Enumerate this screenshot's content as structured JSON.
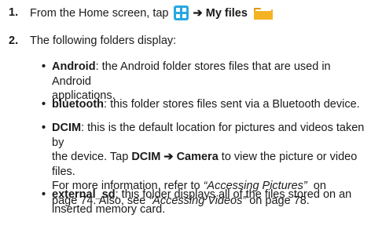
{
  "steps": [
    {
      "number": "1.",
      "text_before": "From the Home screen, tap ",
      "arrow": "➔",
      "target": "My files",
      "icons": [
        "apps-grid-icon",
        "folder-icon"
      ]
    },
    {
      "number": "2.",
      "text": "The following folders display:"
    }
  ],
  "folders": [
    {
      "name": "Android",
      "description_lines": [
        ": the Android folder stores files that are used in Android",
        "applications."
      ]
    },
    {
      "name": "bluetooth",
      "description_lines": [
        ": this folder stores files sent via a Bluetooth device."
      ]
    },
    {
      "name": "DCIM",
      "line1": ": this is the default location for pictures and videos taken by",
      "line2_pre": "the device. Tap ",
      "line2_bold": "DCIM ➔ Camera",
      "line2_post": " to view the picture or video files.",
      "line3_pre": "For more information, refer to ",
      "line3_ref": "“Accessing Pictures”",
      "line3_post": "  on",
      "line4_pre": "page 74. Also, see ",
      "line4_ref": "“Accessing Videos”",
      "line4_post": " on page 78."
    },
    {
      "name": "external_sd",
      "description_lines": [
        ": this folder displays all of the files stored on an",
        "inserted memory card."
      ]
    }
  ],
  "colors": {
    "apps_icon": "#27a8e0",
    "folder_icon": "#f5b324"
  }
}
